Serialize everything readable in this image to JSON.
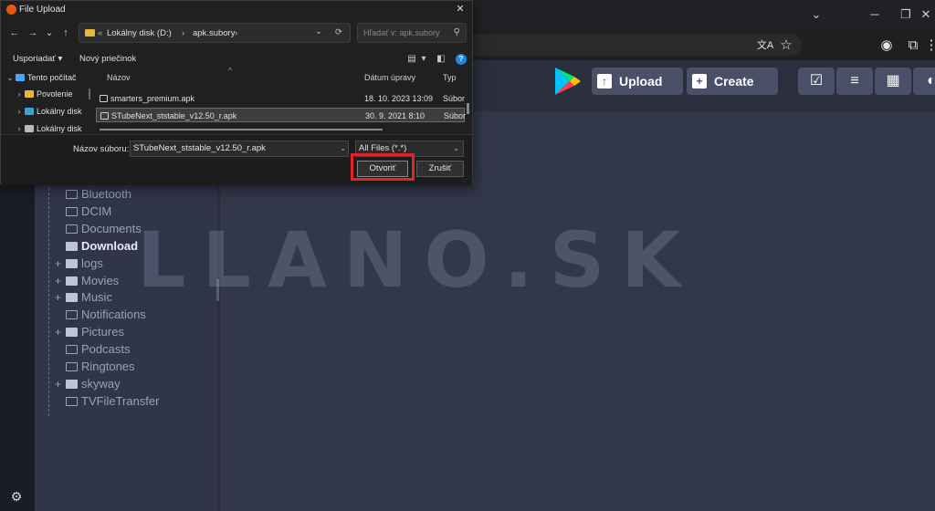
{
  "dialog": {
    "title": "File Upload",
    "close": "✕",
    "nav": {
      "back": "←",
      "forward": "→",
      "down": "⌄",
      "up": "↑"
    },
    "breadcrumb": {
      "sep0": "«",
      "part1": "Lokálny disk (D:)",
      "sep1": "›",
      "part2": "apk.subory",
      "sep2": "›",
      "dropdown": "⌄",
      "refresh": "⟳"
    },
    "search_placeholder": "Hľadať v: apk.subory",
    "search_icon": "⚲",
    "cmd": {
      "organize": "Usporiadať ▾",
      "new_folder": "Nový priečinok",
      "view": "▤",
      "view_drop": "▾",
      "pane": "◧",
      "help": "?"
    },
    "nav_items": [
      {
        "chev": "⌄",
        "label": "Tento počítač",
        "color": "#4aa3ff"
      },
      {
        "chev": "›",
        "label": "Povolenie",
        "color": "#e8b73a"
      },
      {
        "chev": "›",
        "label": "Lokálny disk",
        "color": "#3fa0d9"
      },
      {
        "chev": "›",
        "label": "Lokálny disk",
        "color": "#bbbbbb"
      }
    ],
    "columns": {
      "name": "Názov",
      "date": "Dátum úpravy",
      "type": "Typ",
      "sort": "^"
    },
    "files": [
      {
        "name": "smarters_premium.apk",
        "date": "18. 10. 2023 13:09",
        "type": "Súbor"
      },
      {
        "name": "STubeNext_ststable_v12.50_r.apk",
        "date": "30. 9. 2021 8:10",
        "type": "Súbor"
      }
    ],
    "filename_label": "Názov súboru:",
    "filename_value": "STubeNext_ststable_v12.50_r.apk",
    "filename_drop": "⌄",
    "filetype": "All Files (*.*)",
    "filetype_drop": "⌄",
    "open_button": "Otvoriť",
    "cancel_button": "Zrušiť",
    "grip": "⋰"
  },
  "browser": {
    "win_controls": {
      "chevron": "⌄",
      "minimize": "─",
      "restore": "❐",
      "close": "✕"
    },
    "icons": {
      "translate": "文A",
      "star": "☆",
      "profile": "◉",
      "extensions": "⧉",
      "menu": "⋮"
    }
  },
  "app": {
    "upload_label": "Upload",
    "upload_icon": "↑",
    "create_label": "Create",
    "create_icon": "+",
    "tools": [
      "☑",
      "≡",
      "▦",
      "◐"
    ],
    "watermark": "LLANO.SK",
    "settings_icon": "⚙",
    "folders": [
      {
        "name": "Bluetooth",
        "exp": "",
        "filled": false,
        "bold": false
      },
      {
        "name": "DCIM",
        "exp": "",
        "filled": false,
        "bold": false
      },
      {
        "name": "Documents",
        "exp": "",
        "filled": false,
        "bold": false
      },
      {
        "name": "Download",
        "exp": "",
        "filled": true,
        "bold": true
      },
      {
        "name": "logs",
        "exp": "+",
        "filled": true,
        "bold": false
      },
      {
        "name": "Movies",
        "exp": "+",
        "filled": true,
        "bold": false
      },
      {
        "name": "Music",
        "exp": "+",
        "filled": true,
        "bold": false
      },
      {
        "name": "Notifications",
        "exp": "",
        "filled": false,
        "bold": false
      },
      {
        "name": "Pictures",
        "exp": "+",
        "filled": true,
        "bold": false
      },
      {
        "name": "Podcasts",
        "exp": "",
        "filled": false,
        "bold": false
      },
      {
        "name": "Ringtones",
        "exp": "",
        "filled": false,
        "bold": false
      },
      {
        "name": "skyway",
        "exp": "+",
        "filled": true,
        "bold": false
      },
      {
        "name": "TVFileTransfer",
        "exp": "",
        "filled": false,
        "bold": false
      }
    ]
  }
}
